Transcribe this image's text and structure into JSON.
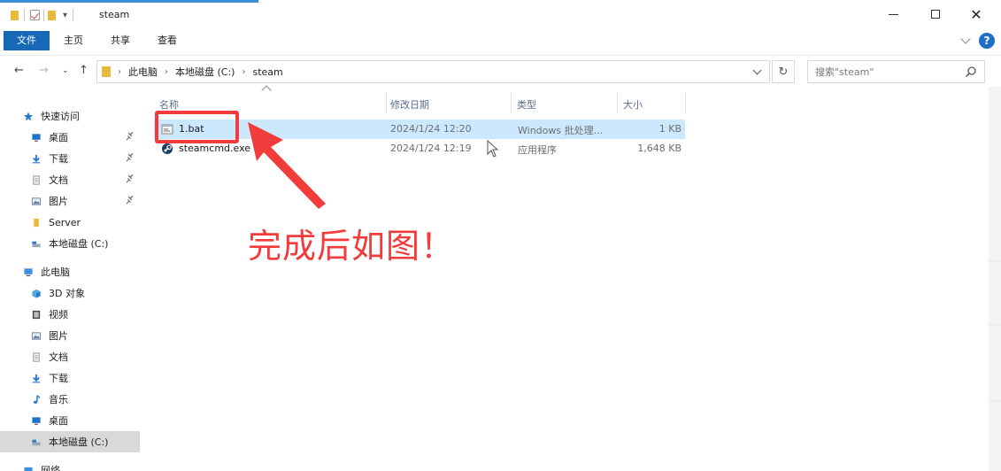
{
  "window": {
    "title": "steam",
    "controls": {
      "minimize": "—",
      "maximize": "☐",
      "close": "✕"
    }
  },
  "ribbon": {
    "tabs": [
      "文件",
      "主页",
      "共享",
      "查看"
    ],
    "help": "?"
  },
  "address": {
    "crumbs": [
      "此电脑",
      "本地磁盘 (C:)",
      "steam"
    ],
    "search_placeholder": "搜索\"steam\""
  },
  "sidebar": {
    "quick_access": "快速访问",
    "quick_items": [
      {
        "label": "桌面",
        "icon": "desktop-icon",
        "pinned": true
      },
      {
        "label": "下载",
        "icon": "download-icon",
        "pinned": true
      },
      {
        "label": "文档",
        "icon": "document-icon",
        "pinned": true
      },
      {
        "label": "图片",
        "icon": "picture-icon",
        "pinned": true
      },
      {
        "label": "Server",
        "icon": "folder-icon",
        "pinned": false
      },
      {
        "label": "本地磁盘 (C:)",
        "icon": "drive-icon",
        "pinned": false
      }
    ],
    "this_pc": "此电脑",
    "pc_items": [
      {
        "label": "3D 对象",
        "icon": "cube-icon"
      },
      {
        "label": "视频",
        "icon": "video-icon"
      },
      {
        "label": "图片",
        "icon": "picture-icon"
      },
      {
        "label": "文档",
        "icon": "document-icon"
      },
      {
        "label": "下载",
        "icon": "download-icon"
      },
      {
        "label": "音乐",
        "icon": "music-icon"
      },
      {
        "label": "桌面",
        "icon": "desktop-icon"
      },
      {
        "label": "本地磁盘 (C:)",
        "icon": "drive-icon"
      }
    ],
    "network": "网络"
  },
  "files": {
    "columns": [
      "名称",
      "修改日期",
      "类型",
      "大小"
    ],
    "rows": [
      {
        "name": "1.bat",
        "date": "2024/1/24 12:20",
        "type": "Windows 批处理...",
        "size": "1 KB",
        "selected": true,
        "icon": "batch-file-icon"
      },
      {
        "name": "steamcmd.exe",
        "date": "2024/1/24 12:19",
        "type": "应用程序",
        "size": "1,648 KB",
        "selected": false,
        "icon": "steam-app-icon"
      }
    ]
  },
  "annotation": {
    "caption": "完成后如图！",
    "color": "#f23b3b"
  }
}
